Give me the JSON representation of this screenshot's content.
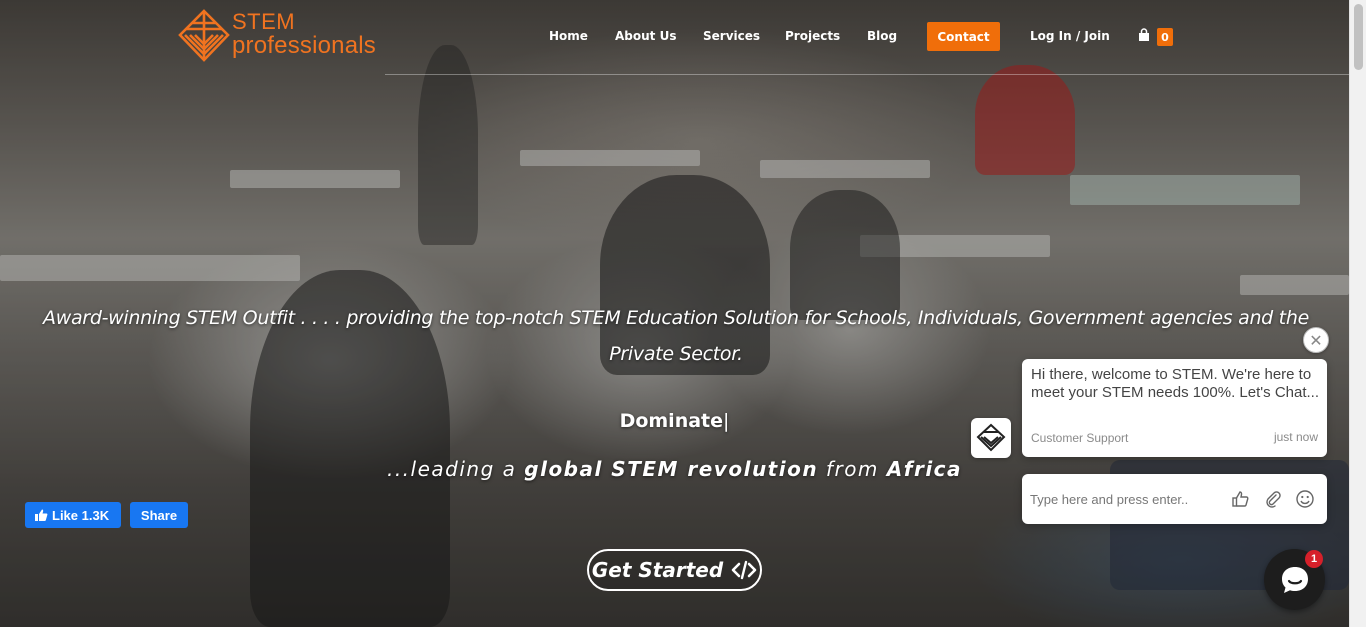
{
  "brand": {
    "logo_line1": "STEM",
    "logo_line2": "professionals",
    "accent_color": "#f06e0a"
  },
  "nav": {
    "items": [
      {
        "label": "Home"
      },
      {
        "label": "About Us"
      },
      {
        "label": "Services"
      },
      {
        "label": "Projects"
      },
      {
        "label": "Blog"
      }
    ],
    "contact_label": "Contact",
    "login_label": "Log In / Join",
    "cart_icon": "shopping-bag-icon",
    "cart_count": "0"
  },
  "hero": {
    "tagline": "Award-winning STEM Outfit . . . . providing the top-notch STEM Education Solution for Schools, Individuals, Government agencies and the Private Sector.",
    "typed_word": "Dominate",
    "sub_prefix": "...leading a ",
    "sub_bold1": "global STEM revolution",
    "sub_mid": " from ",
    "sub_bold2": "Africa",
    "cta_label": "Get Started",
    "cta_icon": "code-icon"
  },
  "social": {
    "like_label": "Like 1.3K",
    "share_label": "Share",
    "color": "#1877f2"
  },
  "chat": {
    "message": "Hi there, welcome to STEM. We're here to meet your STEM needs 100%. Let's Chat...",
    "sender": "Customer Support",
    "time": "just now",
    "input_placeholder": "Type here and press enter..",
    "unread_count": "1",
    "badge_color": "#d6202a"
  }
}
